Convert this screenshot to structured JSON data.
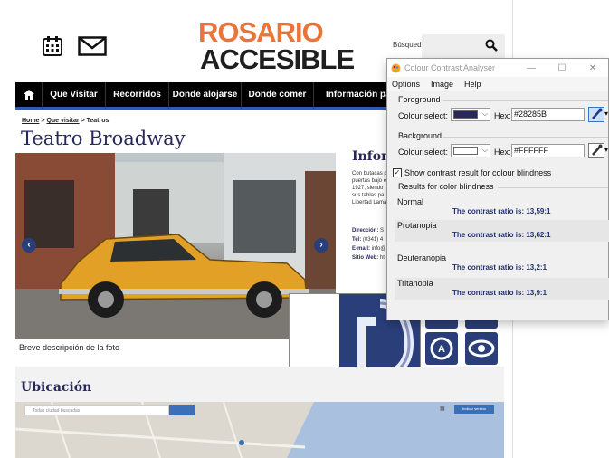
{
  "site": {
    "logo_line1": "ROSARIO",
    "logo_line2": "ACCESIBLE",
    "search_label": "Búsqueda",
    "nav": [
      "Que Visitar",
      "Recorridos",
      "Donde alojarse",
      "Donde comer",
      "Información para tu"
    ],
    "breadcrumb": {
      "home": "Home",
      "sep1": " > ",
      "visitar": "Que visitar",
      "sep2": " > ",
      "current": "Teatros"
    },
    "page_title": "Teatro Broadway",
    "caption": "Breve descripción de la foto",
    "info_title": "Inform",
    "info_lines": [
      "Con butacas p",
      "puertas bajo e",
      "1927, siendo",
      "sus tablas pa",
      "Libertad Lama"
    ],
    "contact": {
      "direccion_label": "Dirección:",
      "direccion": "S",
      "tel_label": "Tel:",
      "tel": "(0341) 4",
      "email_label": "E-mail:",
      "email": "info@",
      "web_label": "Sitio Web:",
      "web": "ht"
    },
    "ubicacion_title": "Ubicación",
    "map_search_placeholder": "Todas ciudad buscadas",
    "map_button": "Indicar sentido",
    "colors": {
      "brand_orange": "#e8763b",
      "brand_navy": "#28285b",
      "nav_accent": "#2f5bb7"
    }
  },
  "cca": {
    "title": "Colour Contrast Analyser",
    "menu": [
      "Options",
      "Image",
      "Help"
    ],
    "foreground": {
      "group_label": "Foreground",
      "select_label": "Colour select:",
      "hex_label": "Hex:",
      "hex": "#28285B",
      "color": "#28285B"
    },
    "background": {
      "group_label": "Background",
      "select_label": "Colour select:",
      "hex_label": "Hex:",
      "hex": "#FFFFFF",
      "color": "#FFFFFF"
    },
    "blindness_checkbox": "Show contrast result for colour blindness",
    "results_label": "Results for color blindness",
    "results": [
      {
        "name": "Normal",
        "ratio": "The contrast ratio is: 13,59:1"
      },
      {
        "name": "Protanopia",
        "ratio": "The contrast ratio is: 13,62:1"
      },
      {
        "name": "Deuteranopia",
        "ratio": "The contrast ratio is: 13,2:1"
      },
      {
        "name": "Tritanopia",
        "ratio": "The contrast ratio is: 13,9:1"
      }
    ]
  }
}
